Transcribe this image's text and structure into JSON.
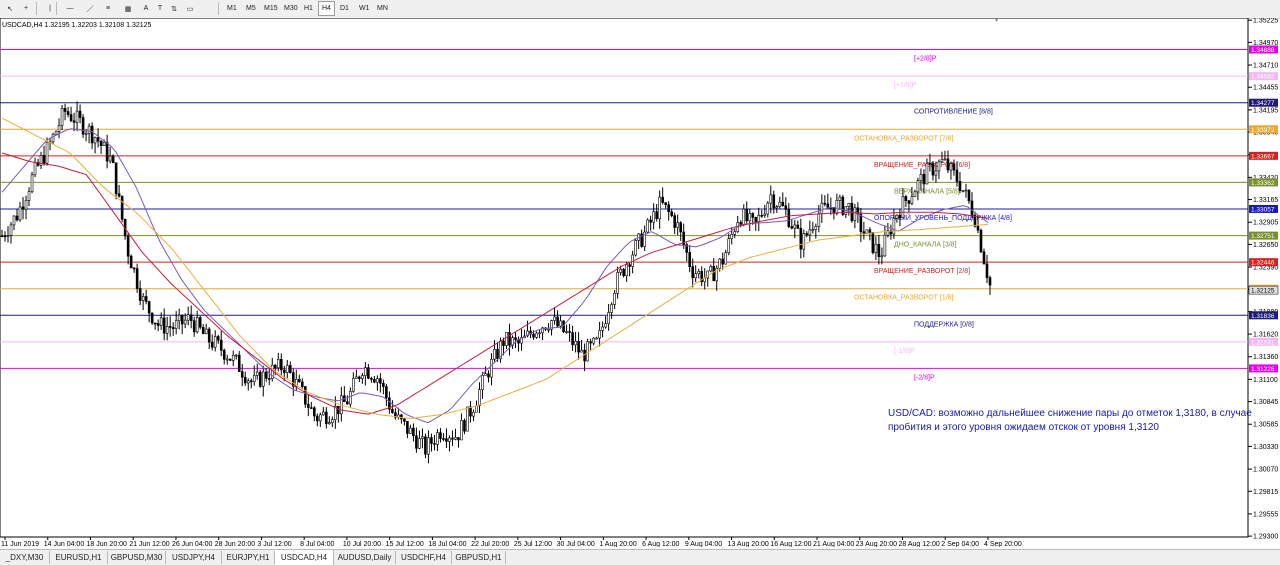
{
  "toolbar": {
    "tools": [
      {
        "name": "cursor-icon",
        "glyph": "↖"
      },
      {
        "name": "crosshair-icon",
        "glyph": "+"
      },
      {
        "name": "vertical-line-icon",
        "glyph": "|"
      },
      {
        "name": "horizontal-line-icon",
        "glyph": "—"
      },
      {
        "name": "trendline-icon",
        "glyph": "／"
      },
      {
        "name": "equidistant-channel-icon",
        "glyph": "≡"
      },
      {
        "name": "fibonacci-icon",
        "glyph": "▦"
      },
      {
        "name": "text-icon",
        "glyph": "A"
      },
      {
        "name": "text-label-icon",
        "glyph": "T"
      },
      {
        "name": "arrows-icon",
        "glyph": "⇅"
      },
      {
        "name": "rectangle-icon",
        "glyph": "▭"
      }
    ],
    "timeframes": [
      "M1",
      "M5",
      "M15",
      "M30",
      "H1",
      "H4",
      "D1",
      "W1",
      "MN"
    ],
    "active_timeframe": "H4"
  },
  "symbol_title": "USDCAD,H4  1.32195 1.32203 1.32108 1.32125",
  "annotation": "USD/CAD: возможно дальнейшее снижение пары до отметок 1,3180, в случае пробития и этого уровня ожидаем отскок от уровня 1,3120",
  "tabs": [
    "_DXY,M30",
    "EURUSD,H1",
    "GBPUSD,M30",
    "USDJPY,H4",
    "EURJPY,H1",
    "USDCAD,H4",
    "AUDUSD,Daily",
    "USDCHF,H4",
    "GBPUSD,H1"
  ],
  "active_tab": "USDCAD,H4",
  "chart_data": {
    "type": "candlestick",
    "symbol": "USDCAD",
    "timeframe": "H4",
    "ylim": [
      1.2929,
      1.3525
    ],
    "y_ticks": [
      "1.35225",
      "1.34970",
      "1.34710",
      "1.34455",
      "1.34195",
      "1.33940",
      "1.33680",
      "1.33420",
      "1.33165",
      "1.32905",
      "1.32650",
      "1.32390",
      "1.32135",
      "1.31880",
      "1.31620",
      "1.31360",
      "1.31100",
      "1.30845",
      "1.30585",
      "1.30330",
      "1.30070",
      "1.29815",
      "1.29555",
      "1.29300"
    ],
    "x_labels": [
      "11 Jun 2019",
      "14 Jun 04:00",
      "18 Jun 20:00",
      "21 Jun 12:00",
      "26 Jun 04:00",
      "28 Jun 20:00",
      "3 Jul 12:00",
      "8 Jul 04:00",
      "10 Jul 20:00",
      "15 Jul 12:00",
      "18 Jul 04:00",
      "22 Jul 20:00",
      "25 Jul 12:00",
      "30 Jul 04:00",
      "1 Aug 20:00",
      "6 Aug 12:00",
      "9 Aug 04:00",
      "13 Aug 20:00",
      "16 Aug 12:00",
      "21 Aug 04:00",
      "23 Aug 20:00",
      "28 Aug 12:00",
      "2 Sep 04:00",
      "4 Sep 20:00"
    ],
    "close_path": [
      1.3275,
      1.33,
      1.3345,
      1.3378,
      1.3418,
      1.3405,
      1.3388,
      1.336,
      1.326,
      1.32,
      1.3172,
      1.317,
      1.318,
      1.3158,
      1.3145,
      1.3128,
      1.3105,
      1.3118,
      1.3126,
      1.3098,
      1.3066,
      1.3072,
      1.3085,
      1.3125,
      1.3112,
      1.3068,
      1.305,
      1.303,
      1.3052,
      1.3045,
      1.3078,
      1.312,
      1.3155,
      1.315,
      1.3168,
      1.3178,
      1.3162,
      1.3138,
      1.3152,
      1.3215,
      1.325,
      1.3278,
      1.3312,
      1.329,
      1.3236,
      1.3225,
      1.3248,
      1.33,
      1.3285,
      1.3322,
      1.3302,
      1.3266,
      1.33,
      1.331,
      1.3308,
      1.3278,
      1.3252,
      1.33,
      1.3325,
      1.3348,
      1.336,
      1.3338,
      1.33,
      1.3218
    ],
    "price_levels": [
      {
        "label": "[+2/8]P",
        "value": "1.34888",
        "color": "#e800e8"
      },
      {
        "label": "[+1/8]P",
        "value": "1.34582",
        "color": "#f2b8f2"
      },
      {
        "label": "СОПРОТИВЛЕНИЕ [8/8]",
        "value": "1.34277",
        "color": "#1c1c78"
      },
      {
        "label": "ОСТАНОВКА_РАЗВОРОТ [7/8]",
        "value": "1.33972",
        "color": "#e8a832"
      },
      {
        "label": "ВРАЩЕНИЕ_РАЗВОРОТ [6/8]",
        "value": "1.33667",
        "color": "#d42020"
      },
      {
        "label": "ВЕРХ_КАНАЛА [5/8]",
        "value": "1.33362",
        "color": "#78902a"
      },
      {
        "label": "ОПОРНЫЙ_УРОВЕНЬ_ПОДДЕРЖКА [4/8]",
        "value": "1.33057",
        "color": "#1a1ab4"
      },
      {
        "label": "ДНО_КАНАЛА [3/8]",
        "value": "1.32751",
        "color": "#78902a"
      },
      {
        "label": "ВРАЩЕНИЕ_РАЗВОРОТ [2/8]",
        "value": "1.32446",
        "color": "#d42020"
      },
      {
        "label": "ОСТАНОВКА_РАЗВОРОТ [1/8]",
        "value": "1.32141",
        "color": "#e8a832"
      },
      {
        "label": "ПОДДЕРЖКА [0/8]",
        "value": "1.31836",
        "color": "#1c1c78"
      },
      {
        "label": "[-1/8]P",
        "value": "1.31531",
        "color": "#f2b8f2"
      },
      {
        "label": "[-2/8]P",
        "value": "1.31226",
        "color": "#e800e8"
      }
    ],
    "moving_averages": [
      {
        "color": "#7a5aba",
        "close_path": [
          1.3325,
          1.3355,
          1.3385,
          1.3398,
          1.3395,
          1.3375,
          1.333,
          1.327,
          1.3225,
          1.319,
          1.3165,
          1.314,
          1.3115,
          1.3098,
          1.309,
          1.3085,
          1.3095,
          1.309,
          1.307,
          1.306,
          1.3075,
          1.3105,
          1.313,
          1.3155,
          1.3168,
          1.317,
          1.32,
          1.324,
          1.3268,
          1.328,
          1.3265,
          1.3262,
          1.3272,
          1.3288,
          1.329,
          1.3292,
          1.33,
          1.3308,
          1.3302,
          1.329,
          1.328,
          1.3295,
          1.3305,
          1.331,
          1.329
        ]
      },
      {
        "color": "#c02040",
        "close_path": [
          1.337,
          1.336,
          1.3355,
          1.3345,
          1.33,
          1.3255,
          1.322,
          1.319,
          1.316,
          1.3135,
          1.311,
          1.309,
          1.3075,
          1.307,
          1.308,
          1.31,
          1.312,
          1.314,
          1.316,
          1.318,
          1.32,
          1.322,
          1.324,
          1.3255,
          1.3265,
          1.3275,
          1.3285,
          1.3292,
          1.3298,
          1.33,
          1.3302,
          1.33,
          1.3302,
          1.3302,
          1.33,
          1.3295
        ]
      },
      {
        "color": "#e8b040",
        "close_path": [
          1.341,
          1.339,
          1.337,
          1.333,
          1.33,
          1.326,
          1.321,
          1.316,
          1.312,
          1.3095,
          1.308,
          1.307,
          1.3065,
          1.307,
          1.308,
          1.3095,
          1.311,
          1.3135,
          1.316,
          1.3185,
          1.321,
          1.3235,
          1.325,
          1.326,
          1.327,
          1.3275,
          1.328,
          1.3282,
          1.3285,
          1.3288
        ]
      }
    ],
    "current_price": "1.32125"
  }
}
